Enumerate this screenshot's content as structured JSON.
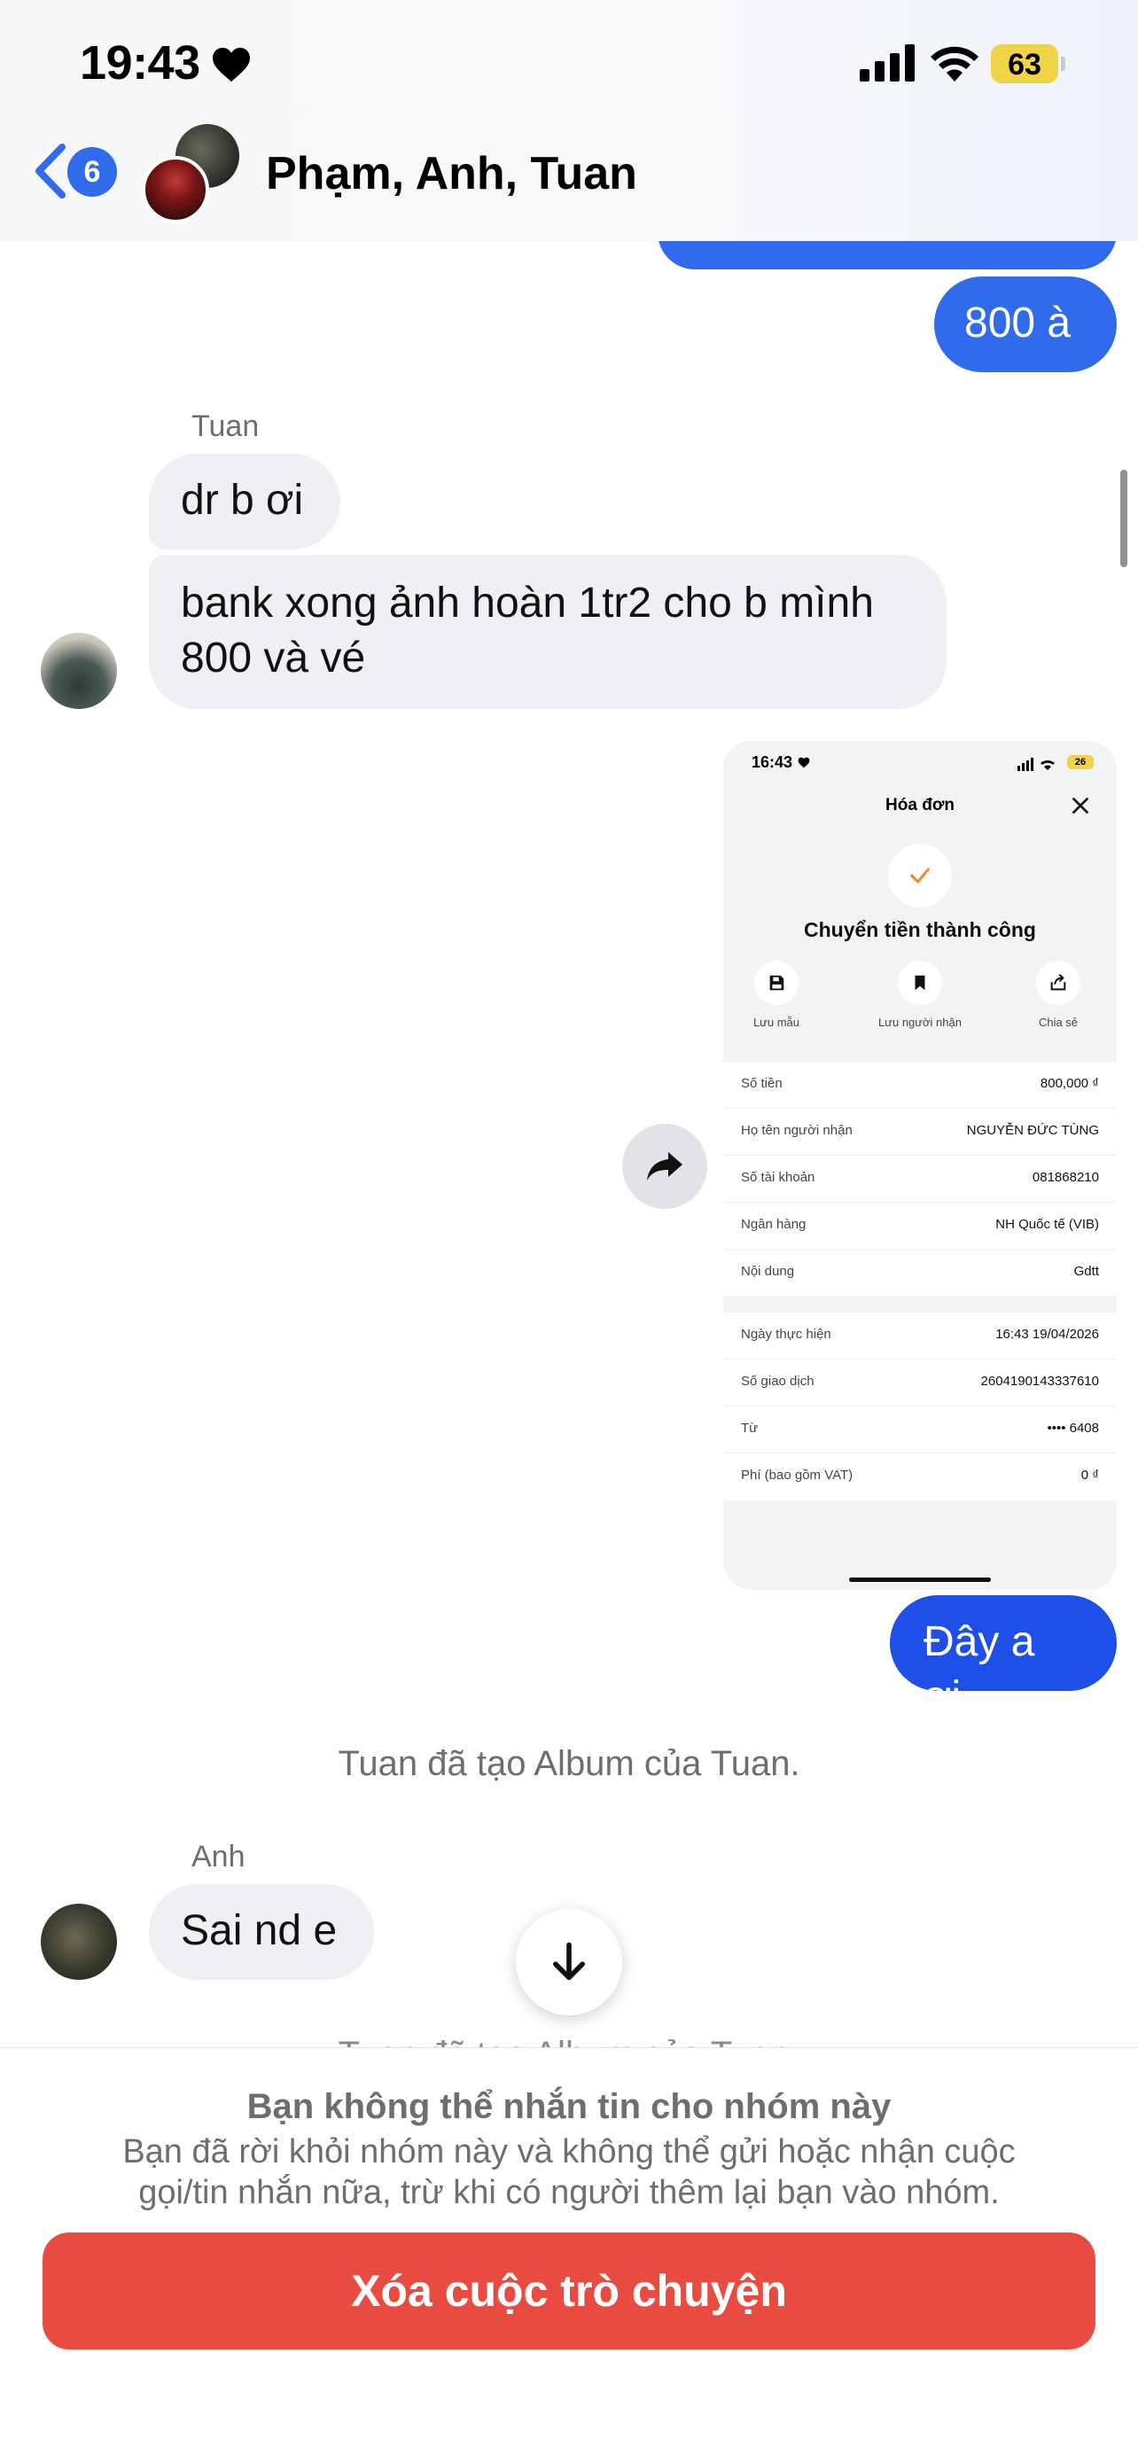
{
  "status_bar": {
    "time": "19:43",
    "battery": "63"
  },
  "header": {
    "back_count": "6",
    "title": "Phạm, Anh, Tuan"
  },
  "messages": {
    "out_1": "800 à",
    "tuan_sender": "Tuan",
    "tuan_1": "dr b ơi",
    "tuan_2_line1": "bank xong ảnh hoàn 1tr2 cho b mình",
    "tuan_2_line2": "800 và vé",
    "out_2": "Đây a ơi",
    "system_1": "Tuan đã tạo Album của Tuan.",
    "anh_sender": "Anh",
    "anh_1": "Sai nd e",
    "system_2": "Tuan đã tạo Album của Tuan."
  },
  "receipt": {
    "time": "16:43",
    "battery": "26",
    "title": "Hóa đơn",
    "headline": "Chuyển tiền thành công",
    "actions": [
      "Lưu mẫu",
      "Lưu người nhận",
      "Chia sẻ"
    ],
    "rows": [
      {
        "label": "Số tiền",
        "value": "800,000 ₫"
      },
      {
        "label": "Họ tên người nhận",
        "value": "NGUYỄN ĐỨC TÙNG"
      },
      {
        "label": "Số tài khoản",
        "value": "081868210"
      },
      {
        "label": "Ngân hàng",
        "value": "NH Quốc tế (VIB)"
      },
      {
        "label": "Nội dung",
        "value": "Gdtt"
      }
    ],
    "rows2": [
      {
        "label": "Ngày thực hiện",
        "value": "16:43 19/04/2026"
      },
      {
        "label": "Số giao dịch",
        "value": "2604190143337610"
      },
      {
        "label": "Từ",
        "value": "•••• 6408"
      },
      {
        "label": "Phí (bao gồm VAT)",
        "value": "0 ₫"
      }
    ]
  },
  "footer": {
    "title": "Bạn không thể nhắn tin cho nhóm này",
    "description": "Bạn đã rời khỏi nhóm này và không thể gửi hoặc nhận cuộc gọi/tin nhắn nữa, trừ khi có người thêm lại bạn vào nhóm.",
    "delete_label": "Xóa cuộc trò chuyện"
  },
  "colors": {
    "accent": "#2f6bea",
    "danger": "#e84c40",
    "bubble_in": "#eef0f4"
  },
  "icons": [
    "heart-icon",
    "signal-icon",
    "wifi-icon",
    "back-chevron-icon",
    "share-arrow-icon",
    "arrow-down-icon",
    "checkmark-icon",
    "close-icon",
    "save-icon",
    "bookmark-icon",
    "share-icon"
  ]
}
